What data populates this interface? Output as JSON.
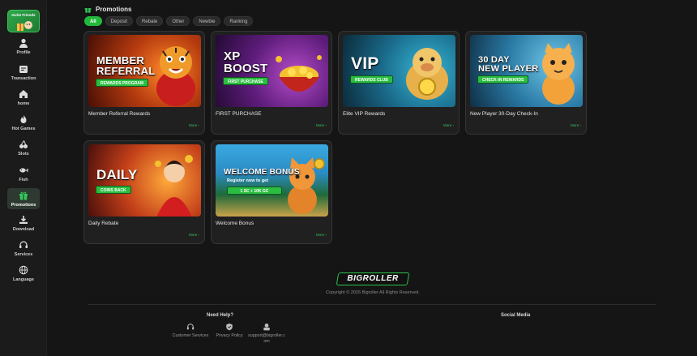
{
  "sidebar": {
    "invite_label": "Invite Friends",
    "items": [
      {
        "label": "Profile",
        "icon": "user-icon"
      },
      {
        "label": "Transaction",
        "icon": "wallet-icon"
      },
      {
        "label": "home",
        "icon": "home-icon"
      },
      {
        "label": "Hot Games",
        "icon": "fire-icon"
      },
      {
        "label": "Slots",
        "icon": "cherry-icon"
      },
      {
        "label": "Fish",
        "icon": "fish-icon"
      },
      {
        "label": "Promotions",
        "icon": "gift-icon",
        "active": true
      },
      {
        "label": "Download",
        "icon": "download-icon"
      },
      {
        "label": "Services",
        "icon": "headset-icon"
      },
      {
        "label": "Language",
        "icon": "globe-icon"
      }
    ]
  },
  "header": {
    "title": "Promotions",
    "tabs": [
      "All",
      "Deposit",
      "Rebate",
      "Other",
      "Newbie",
      "Ranking"
    ],
    "active_tab": "All"
  },
  "promotions": [
    {
      "name": "Member Referral Rewards",
      "banner_line1": "MEMBER",
      "banner_line2": "REFERRAL",
      "banner_pill": "REWARDS PROGRAM",
      "more": "More"
    },
    {
      "name": "FIRST PURCHASE",
      "banner_line1": "XP",
      "banner_line2": "BOOST",
      "banner_pill": "FIRST PURCHASE",
      "more": "More"
    },
    {
      "name": "Elite VIP Rewards",
      "banner_line1": "VIP",
      "banner_pill": "REWARDS CLUB",
      "more": "More"
    },
    {
      "name": "New Player 30-Day Check-In",
      "banner_line1": "30 DAY",
      "banner_line2": "NEW PLAYER",
      "banner_pill": "CHECK-IN REWARDS",
      "more": "More"
    },
    {
      "name": "Daily Rebate",
      "banner_line1": "DAILY",
      "banner_pill": "COINS BACK",
      "more": "More"
    },
    {
      "name": "Welcome Bonus",
      "banner_line1": "WELCOME BONUS",
      "banner_line2": "Register now to get",
      "banner_pill": "1 SC + 10K GC",
      "more": "More"
    }
  ],
  "footer": {
    "logo": "BIGROLLER",
    "copyright": "Copyright © 2026 Bigroller All Rights Reserved.",
    "need_help": "Need Help?",
    "social_media": "Social Media",
    "help_links": [
      {
        "label": "Customer Services",
        "icon": "headset-icon"
      },
      {
        "label": "Privacy Policy",
        "icon": "shield-icon"
      },
      {
        "label": "support@bigroller.com",
        "icon": "mail-icon"
      }
    ]
  },
  "colors": {
    "accent_green": "#22b83c",
    "background": "#151515",
    "card_background": "#202020"
  }
}
